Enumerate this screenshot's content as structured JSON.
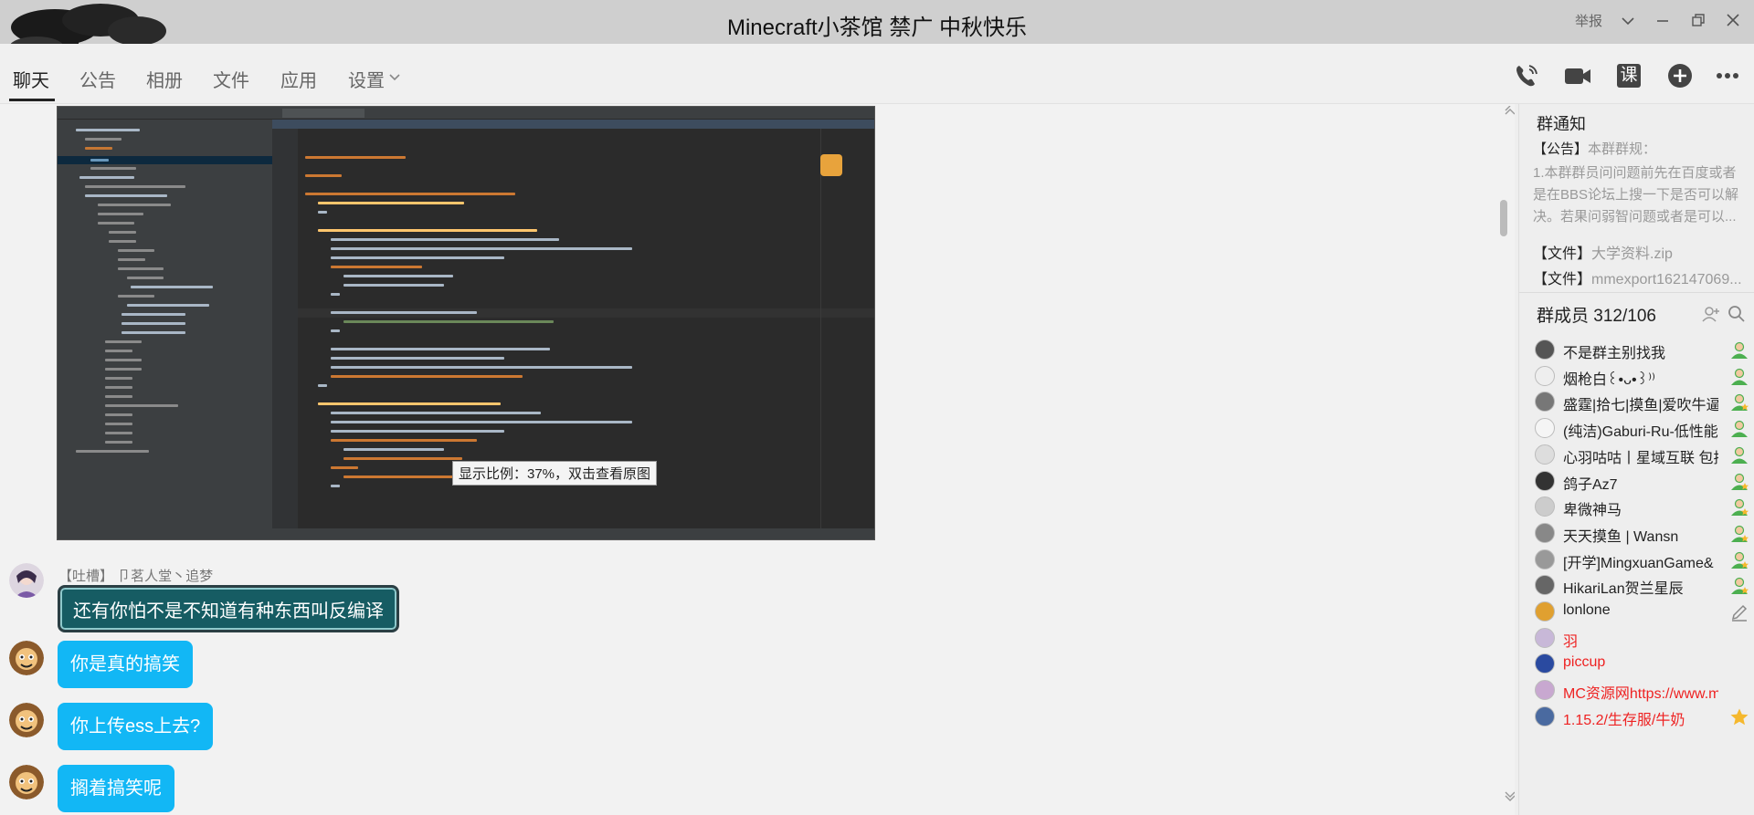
{
  "window": {
    "title": "Minecraft小茶馆 禁广 中秋快乐",
    "report_label": "举报"
  },
  "tabs": [
    {
      "label": "聊天",
      "active": true
    },
    {
      "label": "公告",
      "active": false
    },
    {
      "label": "相册",
      "active": false
    },
    {
      "label": "文件",
      "active": false
    },
    {
      "label": "应用",
      "active": false
    },
    {
      "label": "设置",
      "active": false
    }
  ],
  "toolbar": {
    "icons": [
      "phone-icon",
      "video-icon",
      "class-icon",
      "add-icon",
      "more-icon"
    ],
    "class_label": "课"
  },
  "image_message": {
    "zoom_tip": "显示比例：37%，双击查看原图"
  },
  "messages": [
    {
      "sender": "【吐槽】 卩茗人堂丶追梦",
      "text": "还有你怕不是不知道有种东西叫反编译",
      "style": "special"
    },
    {
      "sender": "",
      "text": "你是真的搞笑",
      "style": "normal"
    },
    {
      "sender": "",
      "text": "你上传ess上去?",
      "style": "normal"
    },
    {
      "sender": "",
      "text": "搁着搞笑呢",
      "style": "normal"
    }
  ],
  "announcements": {
    "title": "群通知",
    "notice_tag": "【公告】",
    "notice_head": "本群群规：",
    "notice_lines": [
      "1.本群群员问问题前先在百度或者",
      "是在BBS论坛上搜一下是否可以解",
      "决。若果问弱智问题或者是可以..."
    ],
    "files": [
      {
        "tag": "【文件】",
        "name": "大学资料.zip"
      },
      {
        "tag": "【文件】",
        "name": "mmexport162147069..."
      }
    ]
  },
  "members": {
    "title": "群成员 312/106",
    "list": [
      {
        "name": "不是群主别找我",
        "red": false,
        "role": "member"
      },
      {
        "name": "烟枪白꒰•ᴗ•꒱⁾⁾",
        "red": false,
        "role": "member"
      },
      {
        "name": "盛霆|拾七|摸鱼|爱吹牛逼",
        "red": false,
        "role": "admin"
      },
      {
        "name": "(纯洁)Gaburi-Ru-低性能",
        "red": false,
        "role": "member"
      },
      {
        "name": "心羽咕咕丨星域互联 包括",
        "red": false,
        "role": "member"
      },
      {
        "name": "鸽子Az7",
        "red": false,
        "role": "admin"
      },
      {
        "name": "卑微神马",
        "red": false,
        "role": "admin"
      },
      {
        "name": "天天摸鱼 | Wansn",
        "red": false,
        "role": "admin"
      },
      {
        "name": "[开学]MingxuanGame&",
        "red": false,
        "role": "admin"
      },
      {
        "name": "HikariLan贺兰星辰",
        "red": false,
        "role": "admin"
      },
      {
        "name": "lonlone",
        "red": false,
        "role": "edit"
      },
      {
        "name": "羽",
        "red": true,
        "role": "none"
      },
      {
        "name": "piccup",
        "red": true,
        "role": "none"
      },
      {
        "name": "MC资源网https://www.mcio",
        "red": true,
        "role": "none"
      },
      {
        "name": "1.15.2/生存服/牛奶",
        "red": true,
        "role": "owner"
      }
    ]
  },
  "colors": {
    "bubble": "#12b7f5",
    "special_bubble": "#165c63",
    "red_name": "#ee2222",
    "member_icon": "#4caf50",
    "owner_icon": "#f5b82e"
  }
}
